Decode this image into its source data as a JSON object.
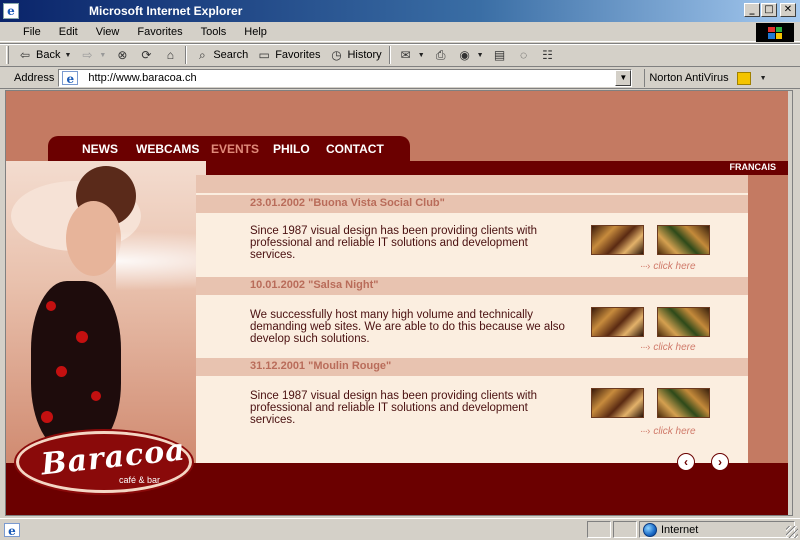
{
  "window": {
    "title": "Microsoft Internet Explorer",
    "app_icon": "e",
    "minimize": "_",
    "maximize": "□",
    "close": "✕"
  },
  "menu": [
    "File",
    "Edit",
    "View",
    "Favorites",
    "Tools",
    "Help"
  ],
  "toolbar": {
    "back": "Back",
    "search": "Search",
    "favorites": "Favorites",
    "history": "History"
  },
  "address": {
    "label": "Address",
    "url": "http://www.baracoa.ch",
    "norton": "Norton AntiVirus"
  },
  "site": {
    "nav": [
      "NEWS",
      "WEBCAMS",
      "EVENTS",
      "PHILO",
      "CONTACT"
    ],
    "active_nav": "EVENTS",
    "language": "FRANCAIS",
    "events": [
      {
        "date": "23.01.2002 \"Buona Vista Social Club\"",
        "text": "Since 1987 visual design has been providing clients with professional and reliable IT solutions and development services.",
        "link": "click here"
      },
      {
        "date": "10.01.2002 \"Salsa Night\"",
        "text": "We successfully host many high volume and technically demanding web sites. We are able to do this because we also develop such solutions.",
        "link": "click here"
      },
      {
        "date": "31.12.2001 \"Moulin Rouge\"",
        "text": "Since 1987 visual design has been providing clients with professional and reliable IT solutions and development services.",
        "link": "click here"
      }
    ],
    "logo": {
      "name": "Baracoa",
      "tagline": "café & bar"
    },
    "prev": "‹",
    "next": "›"
  },
  "status": {
    "zone": "Internet"
  },
  "colors": {
    "brand_dark": "#6b0000",
    "page_bg": "#c47a62",
    "content_bg": "#fbeee0",
    "date_color": "#b96c5a",
    "link_color": "#d07a6a"
  }
}
